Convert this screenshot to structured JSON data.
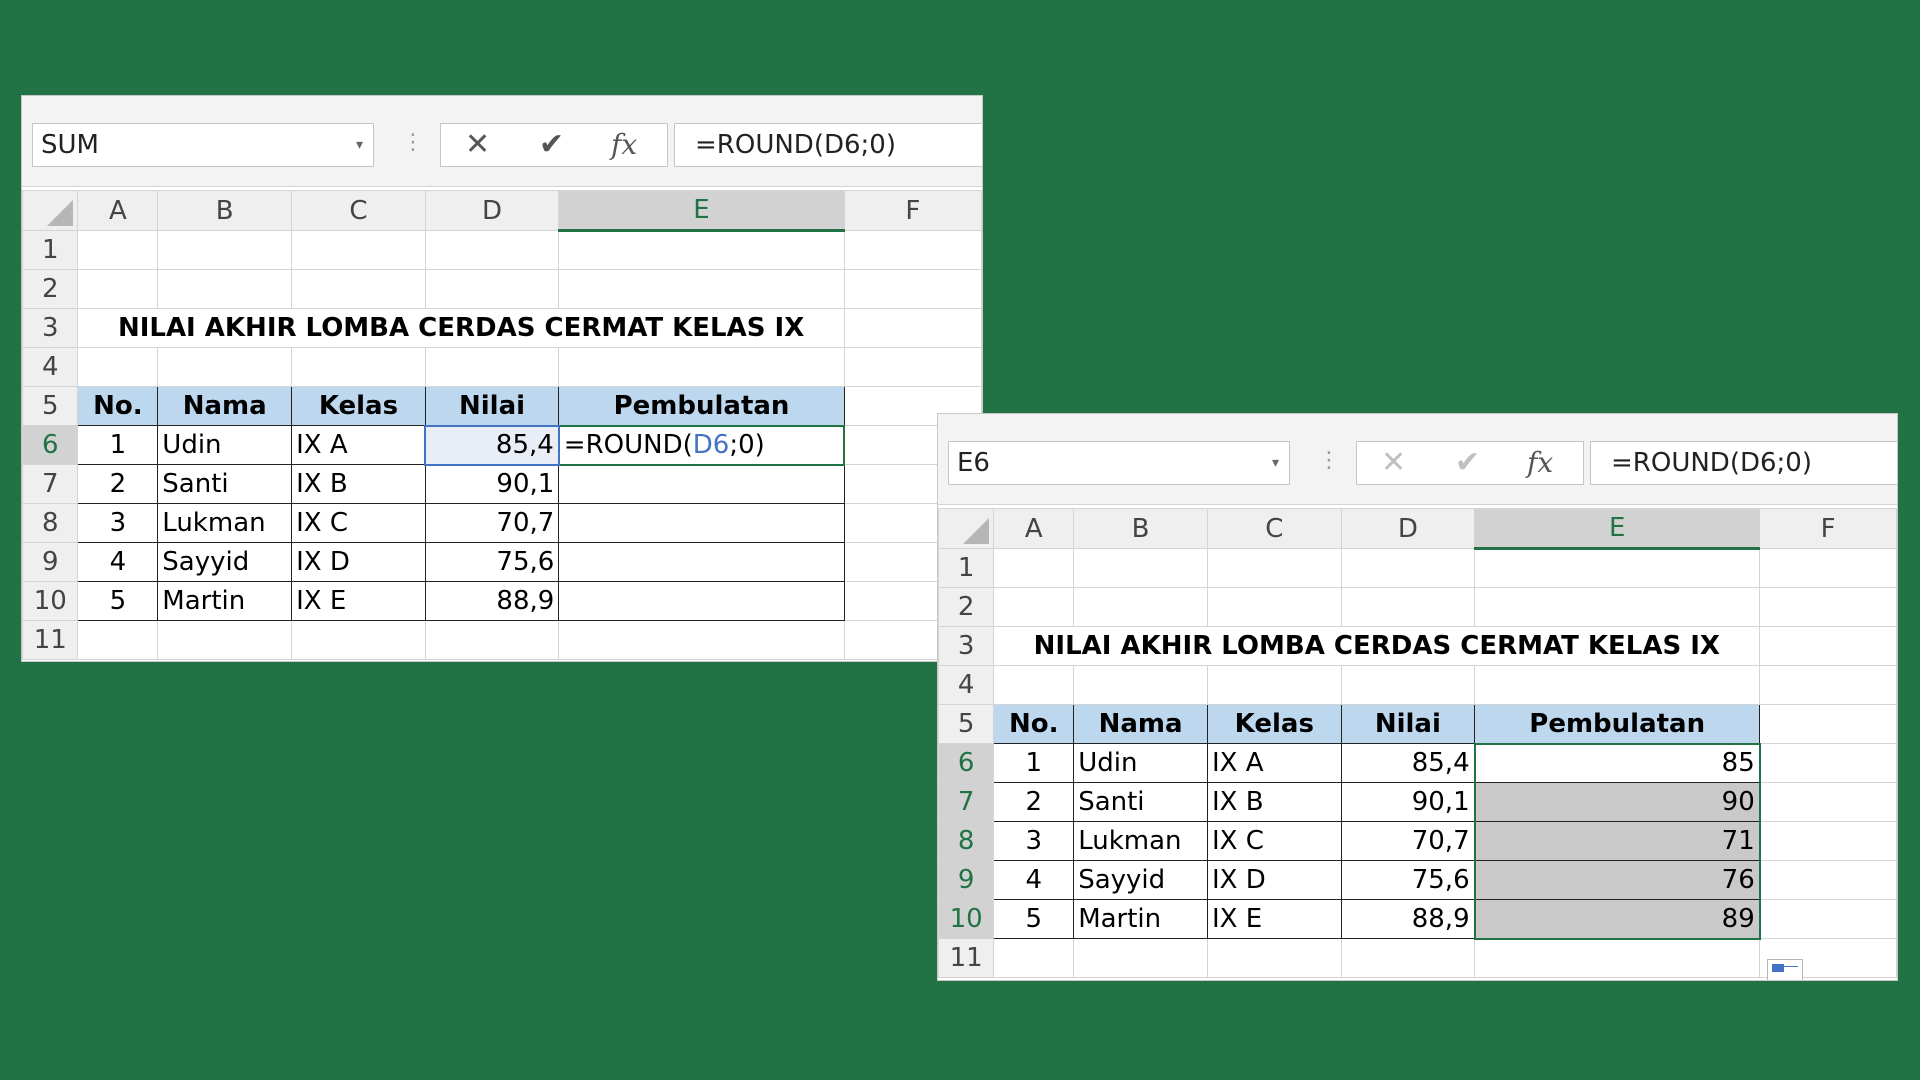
{
  "left": {
    "name_box": "SUM",
    "formula": "=ROUND(D6;0)",
    "columns": [
      "A",
      "B",
      "C",
      "D",
      "E",
      "F"
    ],
    "rows": [
      "1",
      "2",
      "3",
      "4",
      "5",
      "6",
      "7",
      "8",
      "9",
      "10",
      "11"
    ],
    "title": "NILAI AKHIR LOMBA CERDAS CERMAT KELAS IX",
    "headers": [
      "No.",
      "Nama",
      "Kelas",
      "Nilai",
      "Pembulatan"
    ],
    "data": [
      {
        "no": "1",
        "nama": "Udin",
        "kelas": "IX A",
        "nilai": "85,4",
        "pembulatan": ""
      },
      {
        "no": "2",
        "nama": "Santi",
        "kelas": "IX B",
        "nilai": "90,1",
        "pembulatan": ""
      },
      {
        "no": "3",
        "nama": "Lukman",
        "kelas": "IX C",
        "nilai": "70,7",
        "pembulatan": ""
      },
      {
        "no": "4",
        "nama": "Sayyid",
        "kelas": "IX D",
        "nilai": "75,6",
        "pembulatan": ""
      },
      {
        "no": "5",
        "nama": "Martin",
        "kelas": "IX E",
        "nilai": "88,9",
        "pembulatan": ""
      }
    ],
    "edit_formula": {
      "prefix": "=ROUND(",
      "ref": "D6",
      "suffix": ";0)"
    }
  },
  "right": {
    "name_box": "E6",
    "formula": "=ROUND(D6;0)",
    "columns": [
      "A",
      "B",
      "C",
      "D",
      "E",
      "F"
    ],
    "rows": [
      "1",
      "2",
      "3",
      "4",
      "5",
      "6",
      "7",
      "8",
      "9",
      "10",
      "11"
    ],
    "title": "NILAI AKHIR LOMBA CERDAS CERMAT KELAS IX",
    "headers": [
      "No.",
      "Nama",
      "Kelas",
      "Nilai",
      "Pembulatan"
    ],
    "data": [
      {
        "no": "1",
        "nama": "Udin",
        "kelas": "IX A",
        "nilai": "85,4",
        "pembulatan": "85"
      },
      {
        "no": "2",
        "nama": "Santi",
        "kelas": "IX B",
        "nilai": "90,1",
        "pembulatan": "90"
      },
      {
        "no": "3",
        "nama": "Lukman",
        "kelas": "IX C",
        "nilai": "70,7",
        "pembulatan": "71"
      },
      {
        "no": "4",
        "nama": "Sayyid",
        "kelas": "IX D",
        "nilai": "75,6",
        "pembulatan": "76"
      },
      {
        "no": "5",
        "nama": "Martin",
        "kelas": "IX E",
        "nilai": "88,9",
        "pembulatan": "89"
      }
    ]
  },
  "icons": {
    "cancel": "✕",
    "enter": "✔",
    "fx": "fx",
    "dropdown": "▾",
    "dots": "⋮"
  },
  "colors": {
    "background": "#217346",
    "header_fill": "#bdd7ee",
    "selection": "#217346",
    "reference": "#4472c4"
  }
}
